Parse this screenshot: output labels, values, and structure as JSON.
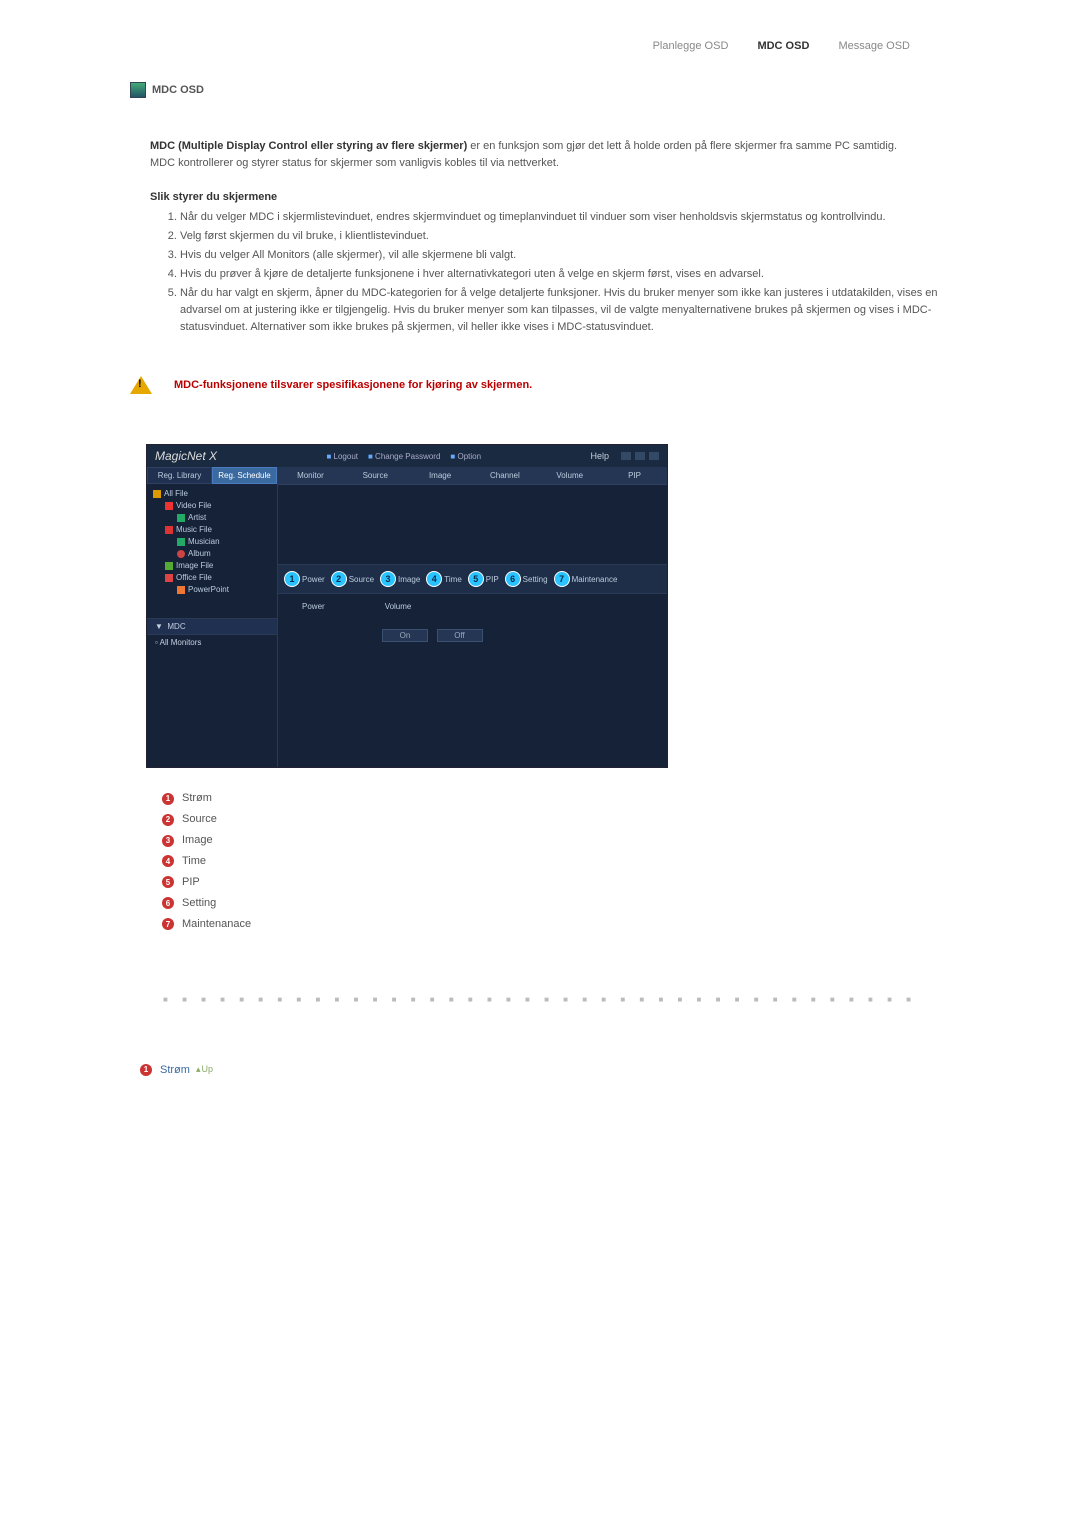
{
  "nav": {
    "planlegge": "Planlegge OSD",
    "mdc": "MDC OSD",
    "message": "Message OSD"
  },
  "heading": "MDC OSD",
  "intro": {
    "bold": "MDC (Multiple Display Control eller styring av flere skjermer)",
    "rest1": " er en funksjon som gjør det lett å holde orden på flere skjermer fra samme PC samtidig.",
    "rest2": "MDC kontrollerer og styrer status for skjermer som vanligvis kobles til via nettverket."
  },
  "subheading": "Slik styrer du skjermene",
  "steps": [
    "Når du velger MDC i skjermlistevinduet, endres skjermvinduet og timeplanvinduet til vinduer som viser henholdsvis skjermstatus og kontrollvindu.",
    "Velg først skjermen du vil bruke, i klientlistevinduet.",
    "Hvis du velger All Monitors (alle skjermer), vil alle skjermene bli valgt.",
    "Hvis du prøver å kjøre de detaljerte funksjonene i hver alternativkategori uten å velge en skjerm først, vises en advarsel.",
    "Når du har valgt en skjerm, åpner du MDC-kategorien for å velge detaljerte funksjoner.\nHvis du bruker menyer som ikke kan justeres i utdatakilden, vises en advarsel om at justering ikke er tilgjengelig. Hvis du bruker menyer som kan tilpasses, vil de valgte menyalternativene brukes på skjermen og vises i MDC-statusvinduet.\nAlternativer som ikke brukes på skjermen, vil heller ikke vises i MDC-statusvinduet."
  ],
  "warning": "MDC-funksjonene tilsvarer spesifikasjonene for kjøring av skjermen.",
  "shot": {
    "logo": "MagicNet X",
    "toolbar": {
      "logout": "Logout",
      "change": "Change Password",
      "option": "Option",
      "help": "Help"
    },
    "tabs": {
      "lib": "Reg. Library",
      "sched": "Reg. Schedule"
    },
    "tree": {
      "root": "All File",
      "video": "Video File",
      "artist": "Artist",
      "music": "Music File",
      "musician": "Musician",
      "album": "Album",
      "image": "Image File",
      "office": "Office File",
      "power": "PowerPoint"
    },
    "mdc": "MDC",
    "allmon": "All Monitors",
    "cols": {
      "monitor": "Monitor",
      "source": "Source",
      "image": "Image",
      "channel": "Channel",
      "volume": "Volume",
      "pip": "PIP"
    },
    "cats": {
      "power": "Power",
      "source": "Source",
      "image": "Image",
      "time": "Time",
      "pip": "PIP",
      "setting": "Setting",
      "maint": "Maintenance"
    },
    "detail": {
      "power": "Power",
      "volume": "Volume",
      "on": "On",
      "off": "Off"
    }
  },
  "legend": [
    "Strøm",
    "Source",
    "Image",
    "Time",
    "PIP",
    "Setting",
    "Maintenanace"
  ],
  "bottom": {
    "strom": "Strøm",
    "up": "Up"
  }
}
